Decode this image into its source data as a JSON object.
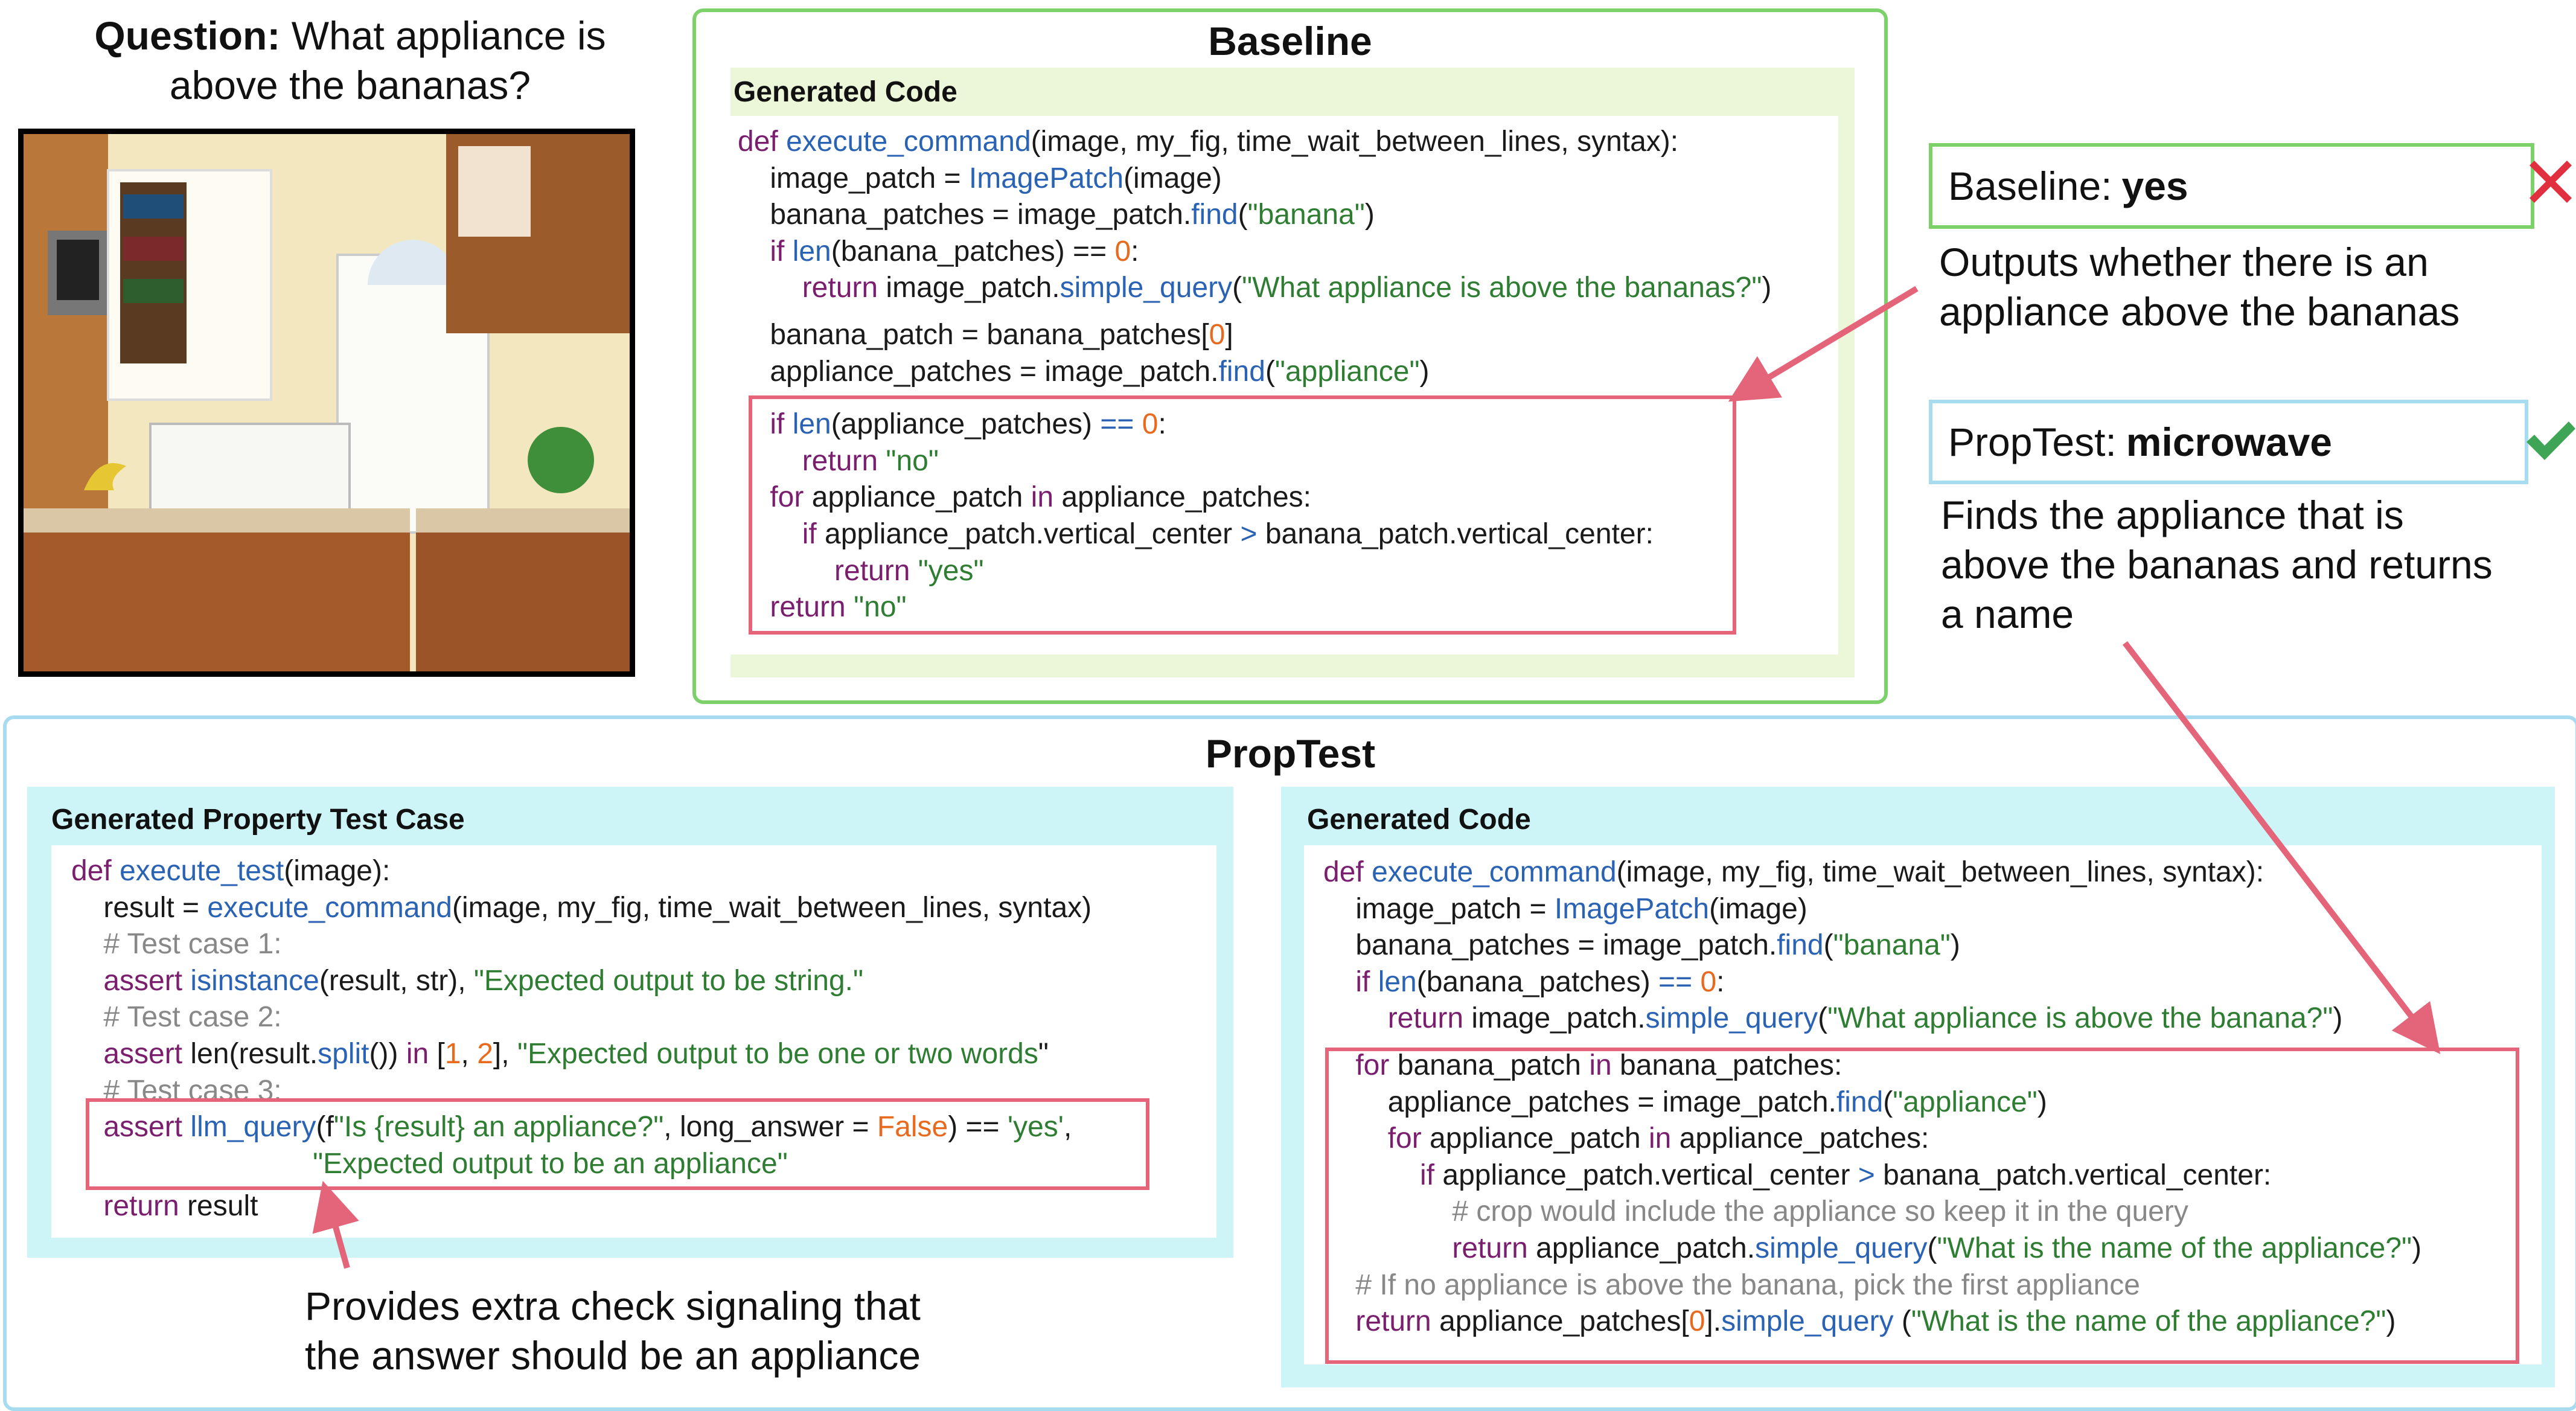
{
  "question": {
    "label": "Question:",
    "text": "What appliance is",
    "text2": "above the bananas?"
  },
  "baseline": {
    "title": "Baseline",
    "code_header": "Generated Code",
    "answer_label": "Baseline:",
    "answer_value": "yes",
    "note_line1": "Outputs whether there is an",
    "note_line2": "appliance above the bananas"
  },
  "proptest_answer": {
    "answer_label": "PropTest:",
    "answer_value": "microwave",
    "note_line1": "Finds the appliance that is",
    "note_line2": "above the bananas and returns",
    "note_line3": "a name"
  },
  "proptest": {
    "title": "PropTest",
    "test_header": "Generated Property Test Case",
    "code_header": "Generated Code",
    "test_note_line1": "Provides extra check signaling that",
    "test_note_line2": "the answer should be an appliance"
  },
  "colors": {
    "green": "#7cd16a",
    "blue": "#a7dcf0",
    "red": "#e46479",
    "cyan": "#cdf4f6",
    "light_green": "#ecf6d9"
  }
}
